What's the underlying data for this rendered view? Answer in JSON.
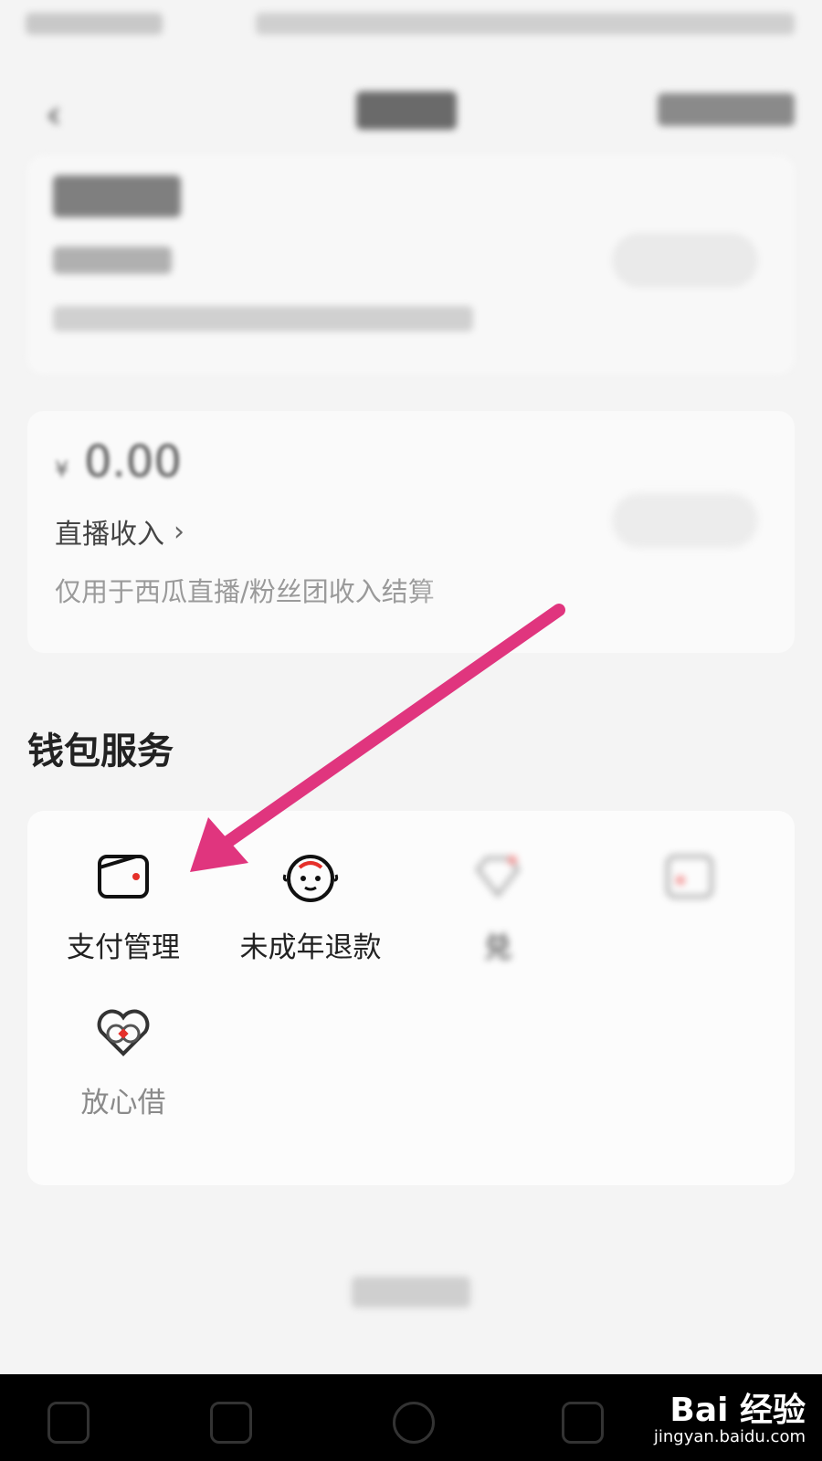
{
  "live_card": {
    "currency": "¥",
    "amount": "0.00",
    "income_label": "直播收入",
    "note": "仅用于西瓜直播/粉丝团收入结算"
  },
  "section_title": "钱包服务",
  "services": [
    {
      "label": "支付管理",
      "icon": "wallet-icon"
    },
    {
      "label": "未成年退款",
      "icon": "child-face-icon"
    },
    {
      "label": "兑",
      "icon": "gift-icon"
    },
    {
      "label": "",
      "icon": "promo-icon"
    },
    {
      "label": "放心借",
      "icon": "heart-loan-icon"
    }
  ],
  "colors": {
    "accent_red": "#e5302a",
    "arrow_pink": "#e0357e"
  },
  "watermark": {
    "brand": "Bai 经验",
    "url": "jingyan.baidu.com"
  }
}
